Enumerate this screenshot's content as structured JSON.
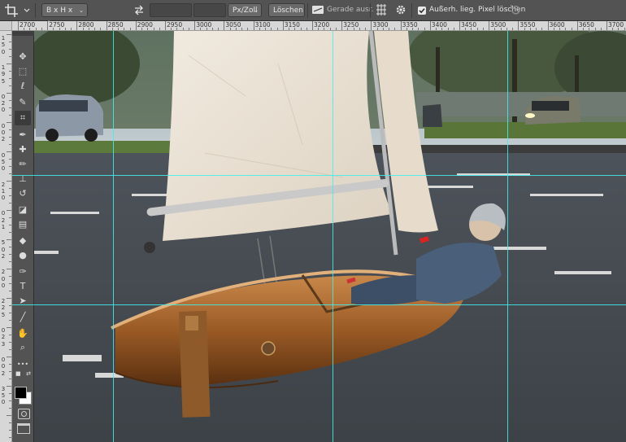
{
  "options_bar": {
    "ratio_dropdown": "B x H x A...",
    "unit_dropdown": "Px/Zoll",
    "clear_button": "Löschen",
    "straighten_label": "Gerade ausr.",
    "delete_pixels_label": "Außerh. lieg. Pixel löschen",
    "delete_pixels_checked": true
  },
  "ruler_h": {
    "labels": [
      "2700",
      "2750",
      "2800",
      "2850",
      "2900",
      "2950",
      "3000",
      "3050",
      "3100",
      "3150",
      "3200",
      "3250",
      "3300",
      "3350",
      "3400",
      "3450",
      "3500",
      "3550",
      "3600",
      "3650",
      "3700"
    ]
  },
  "ruler_v": {
    "labels": [
      "1",
      "5",
      "0",
      "1",
      "9",
      "5",
      "0",
      "2",
      "0",
      "0",
      "0",
      "2",
      "0",
      "5",
      "0",
      "2",
      "1",
      "0",
      "0",
      "2",
      "1",
      "5",
      "0",
      "2",
      "2",
      "0",
      "0",
      "2",
      "2",
      "5",
      "0",
      "2",
      "3",
      "0",
      "0",
      "2",
      "3",
      "5",
      "0"
    ]
  },
  "tools": [
    {
      "icon": "move-tool-icon",
      "glyph": "✥"
    },
    {
      "icon": "marquee-tool-icon",
      "glyph": "⬚"
    },
    {
      "icon": "lasso-tool-icon",
      "glyph": "ℓ"
    },
    {
      "icon": "quick-select-tool-icon",
      "glyph": "✎"
    },
    {
      "icon": "crop-tool-icon",
      "glyph": "⌗"
    },
    {
      "icon": "eyedropper-tool-icon",
      "glyph": "✒"
    },
    {
      "icon": "healing-brush-tool-icon",
      "glyph": "✚"
    },
    {
      "icon": "brush-tool-icon",
      "glyph": "✏"
    },
    {
      "icon": "clone-stamp-tool-icon",
      "glyph": "⊥"
    },
    {
      "icon": "history-brush-tool-icon",
      "glyph": "↺"
    },
    {
      "icon": "eraser-tool-icon",
      "glyph": "◪"
    },
    {
      "icon": "gradient-tool-icon",
      "glyph": "▤"
    },
    {
      "icon": "blur-tool-icon",
      "glyph": "◆"
    },
    {
      "icon": "dodge-tool-icon",
      "glyph": "●"
    },
    {
      "icon": "pen-tool-icon",
      "glyph": "✑"
    },
    {
      "icon": "type-tool-icon",
      "glyph": "T"
    },
    {
      "icon": "path-selection-tool-icon",
      "glyph": "➤"
    },
    {
      "icon": "line-tool-icon",
      "glyph": "╱"
    },
    {
      "icon": "hand-tool-icon",
      "glyph": "✋"
    },
    {
      "icon": "zoom-tool-icon",
      "glyph": "⌕"
    },
    {
      "icon": "more-tools-icon",
      "glyph": "•••"
    }
  ],
  "colors": {
    "foreground": "#000000",
    "background": "#ffffff",
    "guide": "#3ef0f0",
    "panel": "#535353"
  }
}
